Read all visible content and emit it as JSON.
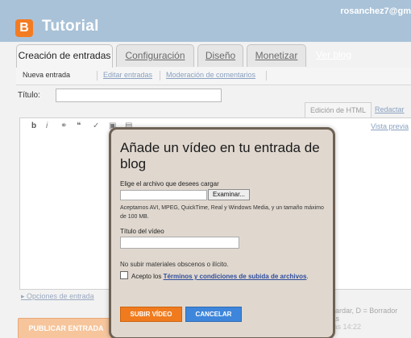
{
  "header": {
    "logo_letter": "B",
    "title": "Tutorial",
    "user": "rosanchez7@gm"
  },
  "tabs": [
    {
      "label": "Creación de entradas"
    },
    {
      "label": "Configuración"
    },
    {
      "label": "Diseño"
    },
    {
      "label": "Monetizar"
    },
    {
      "label": "Ver blog"
    }
  ],
  "subtabs": [
    {
      "label": "Nueva entrada"
    },
    {
      "label": "Editar entradas"
    },
    {
      "label": "Moderación de comentarios"
    }
  ],
  "editor": {
    "title_label": "Título:",
    "html_tab": "Edición de HTML",
    "compose_tab": "Redactar",
    "preview_link": "Vista previa",
    "toolbar": {
      "bold": "b",
      "italic": "i"
    }
  },
  "footer": {
    "post_options": "Opciones de entrada",
    "status_text": "Guardar, D = Borrador más",
    "time_text": "a las 14:22",
    "publish_label": "PUBLICAR ENTRADA"
  },
  "modal": {
    "title": "Añade un vídeo en tu entrada de blog",
    "file_prompt": "Elige el archivo que desees cargar",
    "browse_label": "Examinar...",
    "note": "Aceptamos AVI, MPEG, QuickTime, Real y Windows Media, y un tamaño máximo de 100 MB.",
    "video_title_label": "Título del vídeo",
    "warning": "No subir materiales obscenos o ilícito.",
    "terms_prefix": "Acepto los",
    "terms_link": "Términos y condiciones de subida de archivos",
    "terms_suffix": ".",
    "upload_label": "SUBIR VÍDEO",
    "cancel_label": "CANCELAR"
  },
  "colors": {
    "header_bg": "#a9c2d8",
    "logo_orange": "#f37c22",
    "upload_orange": "#f07b1e",
    "cancel_blue": "#3e86db",
    "modal_bg": "#e0d8cf"
  }
}
